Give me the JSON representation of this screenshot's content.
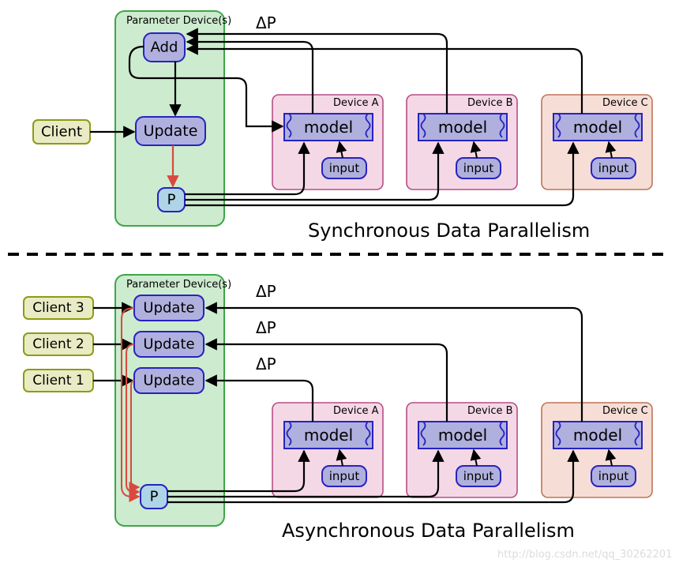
{
  "title_sync": "Synchronous Data Parallelism",
  "title_async": "Asynchronous Data Parallelism",
  "param_device": "Parameter Device(s)",
  "add": "Add",
  "update": "Update",
  "p": "P",
  "client": "Client",
  "client1": "Client 1",
  "client2": "Client 2",
  "client3": "Client 3",
  "device_a": "Device A",
  "device_b": "Device B",
  "device_c": "Device C",
  "model": "model",
  "input": "input",
  "delta_p": "ΔP",
  "watermark": "http://blog.csdn.net/qq_30262201",
  "colors": {
    "green_fill": "#cdebcf",
    "green_stroke": "#3ea648",
    "blue_fill": "#b0b0de",
    "blue_stroke": "#2623c0",
    "lightblue_fill": "#aed4e7",
    "olive_fill": "#e9ebc4",
    "olive_stroke": "#8f9a14",
    "pink_fill": "#f5d8e6",
    "pink_stroke": "#b64e87",
    "salmon_fill": "#f6ded6",
    "salmon_stroke": "#c07358",
    "red_arrow": "#d84a3e",
    "black": "#000000"
  }
}
